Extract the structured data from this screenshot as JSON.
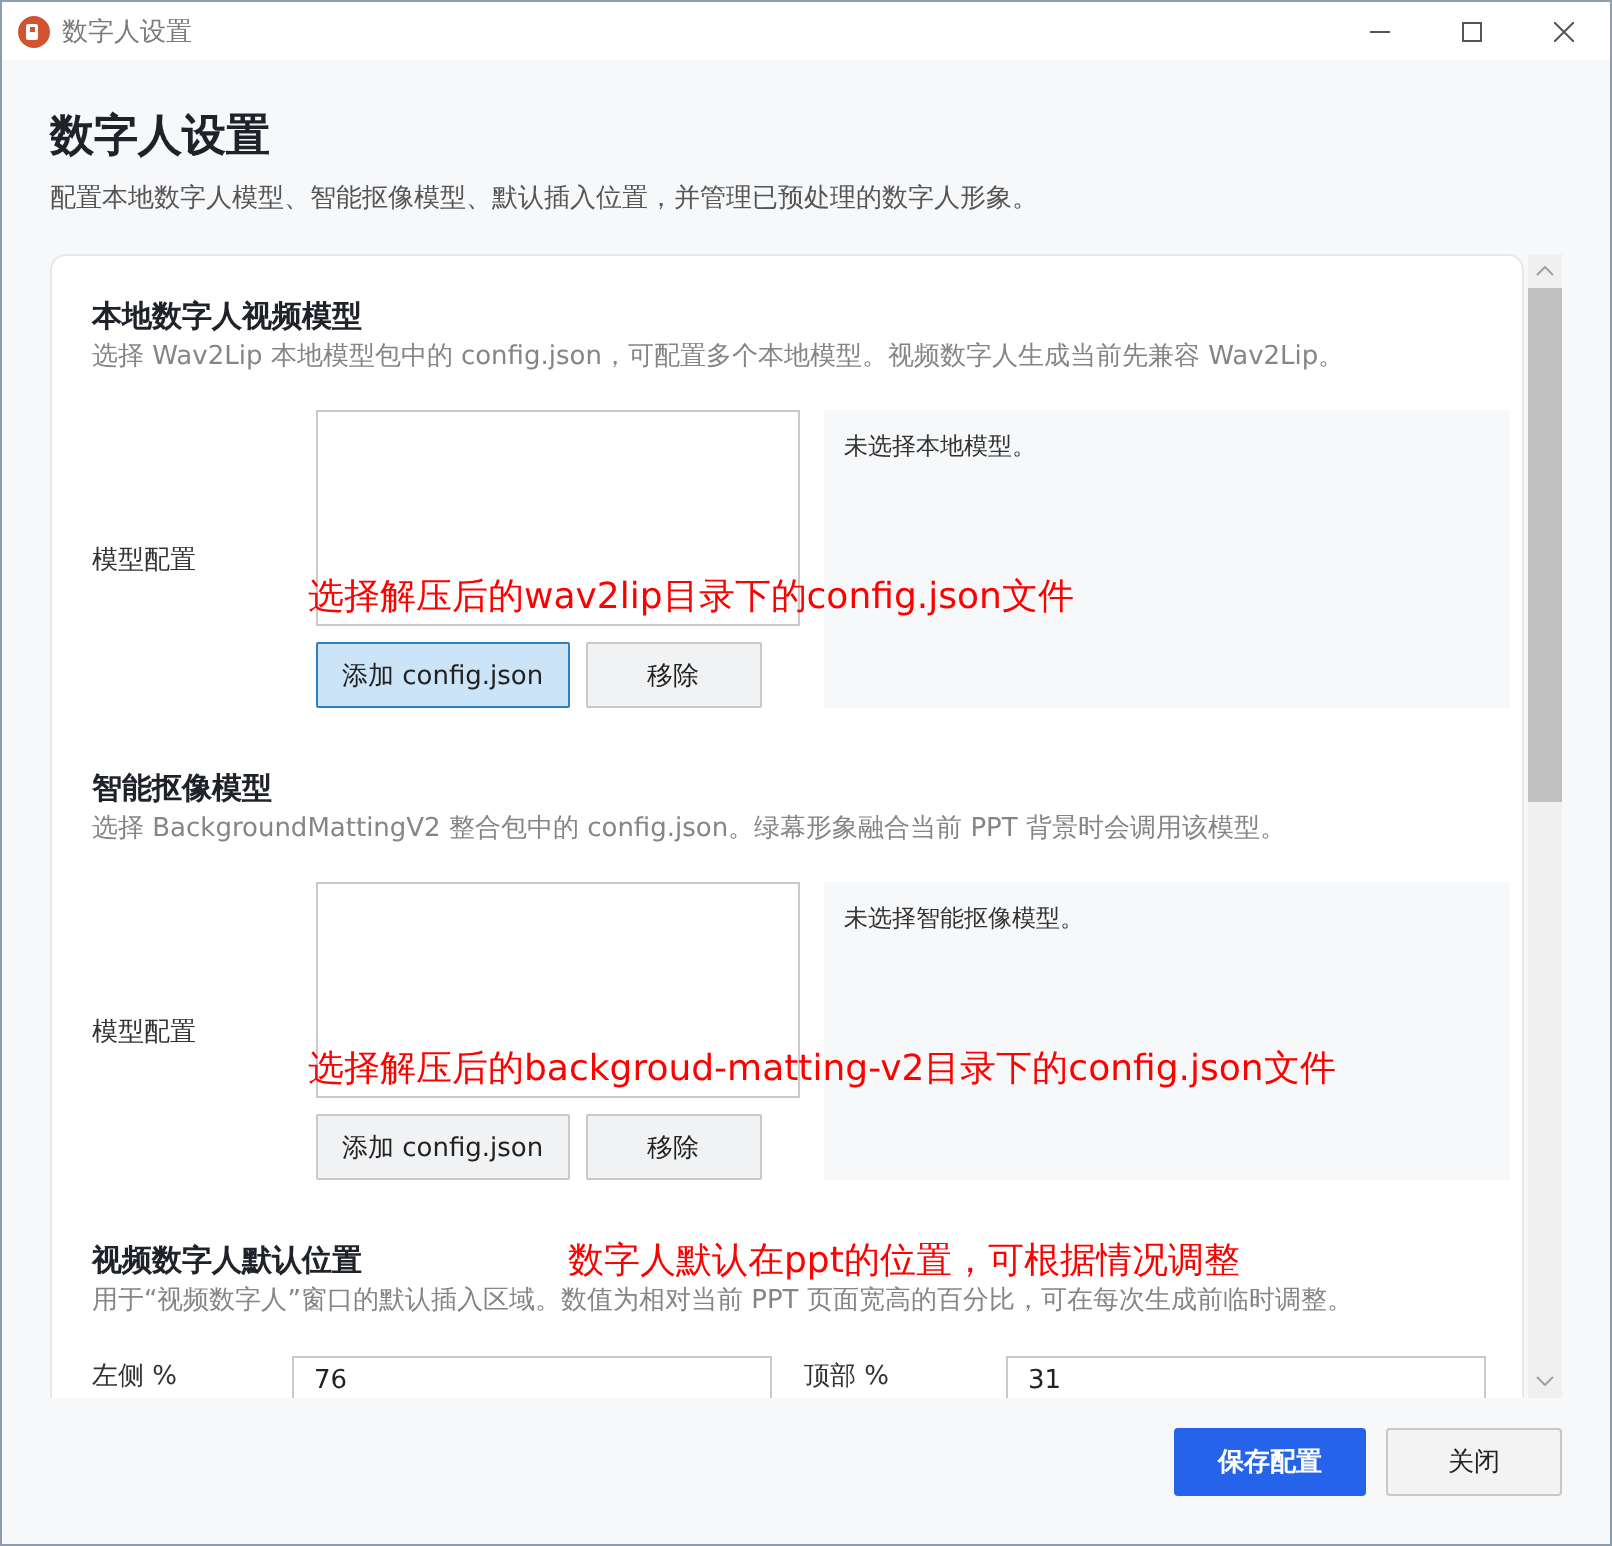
{
  "window": {
    "title": "数字人设置"
  },
  "header": {
    "title": "数字人设置",
    "subtitle": "配置本地数字人模型、智能抠像模型、默认插入位置，并管理已预处理的数字人形象。"
  },
  "sections": [
    {
      "kind": "model",
      "title": "本地数字人视频模型",
      "description": "选择 Wav2Lip 本地模型包中的 config.json，可配置多个本地模型。视频数字人生成当前先兼容 Wav2Lip。",
      "row_label": "模型配置",
      "buttons": [
        {
          "label": "添加 config.json",
          "focused": true
        },
        {
          "label": "移除",
          "focused": false
        }
      ],
      "status": "未选择本地模型。",
      "annotation": "选择解压后的wav2lip目录下的config.json文件"
    },
    {
      "kind": "model",
      "title": "智能抠像模型",
      "description": "选择 BackgroundMattingV2 整合包中的 config.json。绿幕形象融合当前 PPT 背景时会调用该模型。",
      "row_label": "模型配置",
      "buttons": [
        {
          "label": "添加 config.json",
          "focused": false
        },
        {
          "label": "移除",
          "focused": false
        }
      ],
      "status": "未选择智能抠像模型。",
      "annotation": "选择解压后的backgroud-matting-v2目录下的config.json文件"
    },
    {
      "kind": "position",
      "title": "视频数字人默认位置",
      "description": "用于“视频数字人”窗口的默认插入区域。数值为相对当前 PPT 页面宽高的百分比，可在每次生成前临时调整。",
      "fields": [
        {
          "label": "左侧 %",
          "value": "76"
        },
        {
          "label": "顶部 %",
          "value": "31"
        }
      ],
      "annotation": "数字人默认在ppt的位置，可根据情况调整"
    }
  ],
  "footer": {
    "buttons": [
      {
        "label": "保存配置",
        "kind": "primary"
      },
      {
        "label": "关闭",
        "kind": "secondary"
      }
    ]
  }
}
